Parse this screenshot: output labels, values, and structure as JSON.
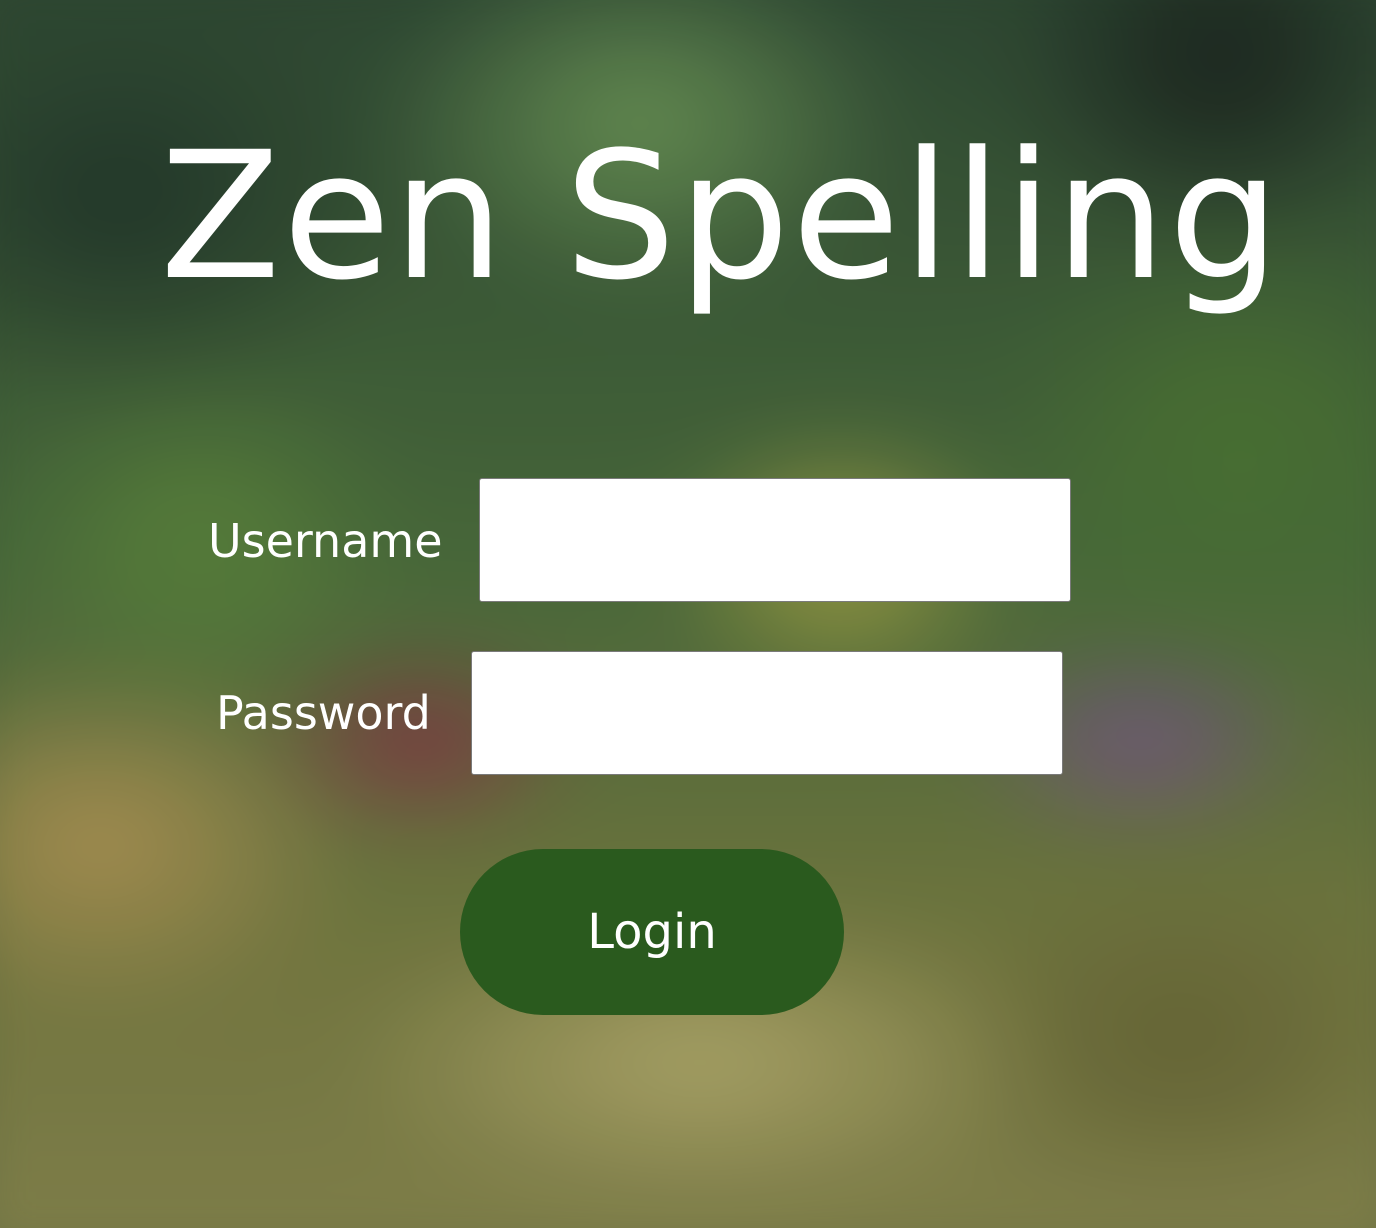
{
  "app": {
    "title": "Zen Spelling"
  },
  "login_form": {
    "username_label": "Username",
    "username_value": "",
    "password_label": "Password",
    "password_value": "",
    "submit_label": "Login"
  },
  "colors": {
    "button_background": "#2a5a1e",
    "text": "#ffffff",
    "input_background": "#ffffff"
  }
}
